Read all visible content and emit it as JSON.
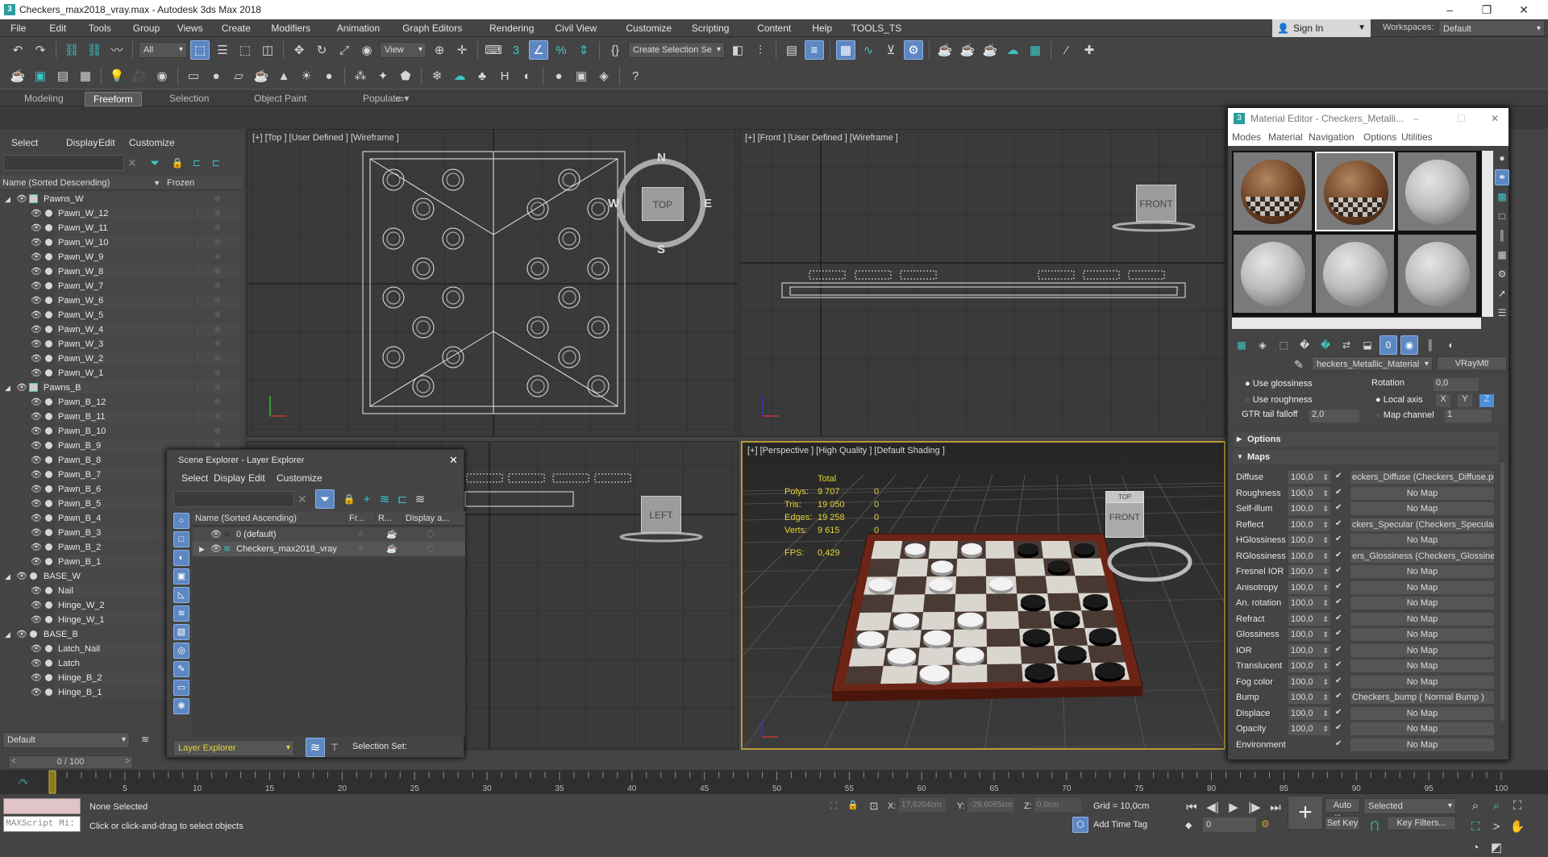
{
  "window": {
    "title": "Checkers_max2018_vray.max - Autodesk 3ds Max 2018",
    "app_icon": "3"
  },
  "menubar": [
    "File",
    "Edit",
    "Tools",
    "Group",
    "Views",
    "Create",
    "Modifiers",
    "Animation",
    "Graph Editors",
    "Rendering",
    "Civil View",
    "Customize",
    "Scripting",
    "Content",
    "Help",
    "TOOLS_TS"
  ],
  "account": {
    "sign_in": "Sign In",
    "workspaces_label": "Workspaces:",
    "workspace": "Default"
  },
  "toolbar": {
    "filter": "All",
    "ref_coord": "View",
    "selection_set": "Create Selection Se",
    "row1_icons": [
      "undo-icon",
      "redo-icon",
      "|",
      "link-icon",
      "unlink-icon",
      "bind-space-warp-icon",
      "|",
      "@filter",
      "select-object-icon*",
      "select-by-name-icon",
      "rect-selection-icon",
      "window-crossing-icon",
      "|",
      "move-icon",
      "rotate-icon",
      "scale-icon",
      "place-icon",
      "@ref",
      "use-pivot-icon",
      "manipulate-icon",
      "|",
      "keyboard-shortcut-icon",
      "snap-3d-icon",
      "angle-snap-icon*",
      "percent-snap-icon",
      "spinner-snap-icon",
      "|",
      "edit-named-selection-icon",
      "@selset",
      "mirror-icon",
      "align-icon",
      "|",
      "toggle-layer-explorer-icon",
      "toggle-ribbon-icon*",
      "|",
      "curve-editor-icon*",
      "schematic-view-icon",
      "material-editor-icon",
      "render-setup-icon*",
      "|",
      "rendered-frame-icon",
      "render-production-icon",
      "render-iterative-icon",
      "render-cloud-icon",
      "render-gallery-icon",
      "|",
      "vray-tool-1-icon",
      "vray-tool-2-icon"
    ],
    "row2_icons": [
      "teapot-icon",
      "render-frame-icon",
      "table-icon",
      "grid-icon",
      "|",
      "light-list-icon",
      "camera-icon",
      "vray-lister-icon",
      "|",
      "box-icon",
      "sphere-icon",
      "plane-icon",
      "teapot-object-icon",
      "cone-icon",
      "sun-icon",
      "ball-icon",
      "|",
      "proxy-icon",
      "fur-icon",
      "mesh-icon",
      "|",
      "vfb-icon",
      "cloud-icon",
      "grass-icon",
      "hdri-icon",
      "sky-icon",
      "|",
      "material-ball-icon",
      "scene-converter-icon",
      "lister-icon",
      "|",
      "help-icon"
    ]
  },
  "ribbon": {
    "tabs": [
      "Modeling",
      "Freeform",
      "Selection",
      "Object Paint",
      "Populate"
    ],
    "active": "Freeform"
  },
  "scene_explorer": {
    "menu": [
      "Select",
      "Display",
      "Edit",
      "Customize"
    ],
    "col_name": "Name (Sorted Descending)",
    "col_frozen": "Frozen",
    "items": [
      {
        "label": "Pawns_W",
        "level": 0,
        "group": true
      },
      {
        "label": "Pawn_W_12",
        "level": 1
      },
      {
        "label": "Pawn_W_11",
        "level": 1
      },
      {
        "label": "Pawn_W_10",
        "level": 1
      },
      {
        "label": "Pawn_W_9",
        "level": 1
      },
      {
        "label": "Pawn_W_8",
        "level": 1
      },
      {
        "label": "Pawn_W_7",
        "level": 1
      },
      {
        "label": "Pawn_W_6",
        "level": 1
      },
      {
        "label": "Pawn_W_5",
        "level": 1
      },
      {
        "label": "Pawn_W_4",
        "level": 1
      },
      {
        "label": "Pawn_W_3",
        "level": 1
      },
      {
        "label": "Pawn_W_2",
        "level": 1
      },
      {
        "label": "Pawn_W_1",
        "level": 1
      },
      {
        "label": "Pawns_B",
        "level": 0,
        "group": true
      },
      {
        "label": "Pawn_B_12",
        "level": 1
      },
      {
        "label": "Pawn_B_11",
        "level": 1
      },
      {
        "label": "Pawn_B_10",
        "level": 1
      },
      {
        "label": "Pawn_B_9",
        "level": 1
      },
      {
        "label": "Pawn_B_8",
        "level": 1
      },
      {
        "label": "Pawn_B_7",
        "level": 1
      },
      {
        "label": "Pawn_B_6",
        "level": 1
      },
      {
        "label": "Pawn_B_5",
        "level": 1
      },
      {
        "label": "Pawn_B_4",
        "level": 1
      },
      {
        "label": "Pawn_B_3",
        "level": 1
      },
      {
        "label": "Pawn_B_2",
        "level": 1
      },
      {
        "label": "Pawn_B_1",
        "level": 1
      },
      {
        "label": "BASE_W",
        "level": 0,
        "group": false
      },
      {
        "label": "Nail",
        "level": 1
      },
      {
        "label": "Hinge_W_2",
        "level": 1
      },
      {
        "label": "Hinge_W_1",
        "level": 1
      },
      {
        "label": "BASE_B",
        "level": 0,
        "group": false
      },
      {
        "label": "Latch_Nail",
        "level": 1
      },
      {
        "label": "Latch",
        "level": 1
      },
      {
        "label": "Hinge_B_2",
        "level": 1
      },
      {
        "label": "Hinge_B_1",
        "level": 1
      }
    ],
    "explorer_select": "Default",
    "frame_slider": "0 / 100"
  },
  "viewports": {
    "top": {
      "label": "[+] [Top ] [User Defined ] [Wireframe ]",
      "cube": "TOP",
      "compass": [
        "N",
        "S",
        "W",
        "E"
      ]
    },
    "front": {
      "label": "[+] [Front ] [User Defined ] [Wireframe ]",
      "cube": "FRONT"
    },
    "left": {
      "cube": "LEFT"
    },
    "perspective": {
      "label": "[+] [Perspective ] [High Quality ] [Default Shading ]",
      "cube_top": "TOP",
      "cube": "FRONT",
      "stats": {
        "header": "Total",
        "rows": [
          {
            "k": "Polys:",
            "v": "9 707",
            "s": "0"
          },
          {
            "k": "Tris:",
            "v": "19 050",
            "s": "0"
          },
          {
            "k": "Edges:",
            "v": "19 258",
            "s": "0"
          },
          {
            "k": "Verts:",
            "v": "9 615",
            "s": "0"
          }
        ],
        "fps_label": "FPS:",
        "fps": "0,429"
      }
    }
  },
  "layer_explorer": {
    "title": "Scene Explorer - Layer Explorer",
    "menu": [
      "Select",
      "Display",
      "Edit",
      "Customize"
    ],
    "cols": [
      "Name (Sorted Ascending)",
      "Fr...",
      "R...",
      "Display a..."
    ],
    "layers": [
      "0 (default)",
      "Checkers_max2018_vray"
    ],
    "footer_select": "Layer Explorer",
    "selection_set": "Selection Set:"
  },
  "material_editor": {
    "title": "Material Editor - Checkers_Metalli...",
    "menu": [
      "Modes",
      "Material",
      "Navigation",
      "Options",
      "Utilities"
    ],
    "material_name": "heckers_Metallic_Material",
    "material_type": "VRayMtl",
    "params": {
      "use_glossiness": "Use glossiness",
      "use_roughness": "Use roughness",
      "gtr_label": "GTR tail falloff",
      "gtr": "2,0",
      "rotation_label": "Rotation",
      "rotation": "0,0",
      "local_axis": "Local axis",
      "axes": [
        "X",
        "Y",
        "Z"
      ],
      "active_axis": "Z",
      "map_channel_label": "Map channel",
      "map_channel": "1"
    },
    "rollouts": {
      "options": "Options",
      "maps": "Maps"
    },
    "maps": [
      {
        "name": "Diffuse",
        "amount": "100,0",
        "map": "eckers_Diffuse (Checkers_Diffuse.pn"
      },
      {
        "name": "Roughness",
        "amount": "100,0",
        "map": "No Map"
      },
      {
        "name": "Self-illum",
        "amount": "100,0",
        "map": "No Map"
      },
      {
        "name": "Reflect",
        "amount": "100,0",
        "map": "ckers_Specular (Checkers_Specular.p"
      },
      {
        "name": "HGlossiness",
        "amount": "100,0",
        "map": "No Map"
      },
      {
        "name": "RGlossiness",
        "amount": "100,0",
        "map": "ers_Glossiness (Checkers_Glossiness"
      },
      {
        "name": "Fresnel IOR",
        "amount": "100,0",
        "map": "No Map"
      },
      {
        "name": "Anisotropy",
        "amount": "100,0",
        "map": "No Map"
      },
      {
        "name": "An. rotation",
        "amount": "100,0",
        "map": "No Map"
      },
      {
        "name": "Refract",
        "amount": "100,0",
        "map": "No Map"
      },
      {
        "name": "Glossiness",
        "amount": "100,0",
        "map": "No Map"
      },
      {
        "name": "IOR",
        "amount": "100,0",
        "map": "No Map"
      },
      {
        "name": "Translucent",
        "amount": "100,0",
        "map": "No Map"
      },
      {
        "name": "Fog color",
        "amount": "100,0",
        "map": "No Map"
      },
      {
        "name": "Bump",
        "amount": "100,0",
        "map": "Checkers_bump ( Normal Bump )"
      },
      {
        "name": "Displace",
        "amount": "100,0",
        "map": "No Map"
      },
      {
        "name": "Opacity",
        "amount": "100,0",
        "map": "No Map"
      },
      {
        "name": "Environment",
        "amount": "",
        "map": "No Map"
      }
    ]
  },
  "timeline": {
    "ticks": [
      "0",
      "5",
      "10",
      "15",
      "20",
      "25",
      "30",
      "35",
      "40",
      "45",
      "50",
      "55",
      "60",
      "65",
      "70",
      "75",
      "80",
      "85",
      "90",
      "95",
      "100"
    ],
    "current_frame": 0
  },
  "status": {
    "selection": "None Selected",
    "prompt": "Click or click-and-drag to select objects",
    "maxscript": "MAXScript Mi:",
    "x_label": "X:",
    "x": "17,6204cm",
    "y_label": "Y:",
    "y": "-29,6065cm",
    "z_label": "Z:",
    "z": "0,0cm",
    "grid": "Grid = 10,0cm",
    "add_time_tag": "Add Time Tag",
    "auto_key": "Auto Key",
    "set_key": "Set Key",
    "key_mode": "Selected",
    "key_filters": "Key Filters...",
    "frame": "0"
  },
  "colors": {
    "accent": "#5d87c2",
    "teal": "#3cc6c6",
    "stats_yellow": "#e3d33a",
    "active_viewport": "#b49a3c"
  }
}
